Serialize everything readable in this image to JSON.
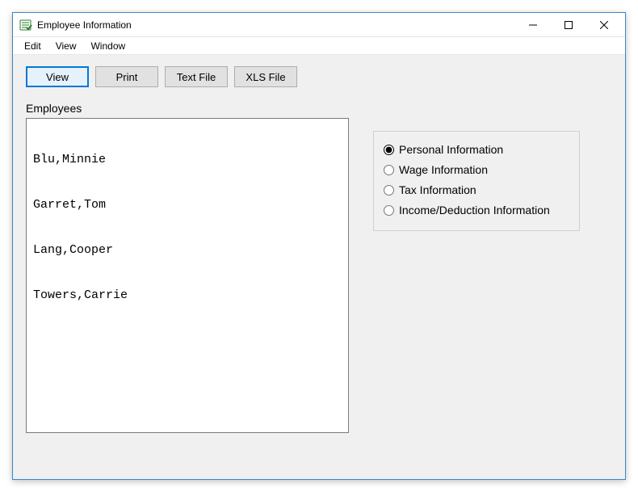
{
  "window": {
    "title": "Employee Information"
  },
  "menubar": {
    "items": [
      "Edit",
      "View",
      "Window"
    ]
  },
  "toolbar": {
    "buttons": [
      {
        "label": "View",
        "selected": true
      },
      {
        "label": "Print",
        "selected": false
      },
      {
        "label": "Text File",
        "selected": false
      },
      {
        "label": "XLS File",
        "selected": false
      }
    ]
  },
  "employees": {
    "label": "Employees",
    "list": [
      "Blu,Minnie",
      "Garret,Tom",
      "Lang,Cooper",
      "Towers,Carrie"
    ]
  },
  "infoOptions": {
    "items": [
      {
        "label": "Personal Information",
        "checked": true
      },
      {
        "label": "Wage Information",
        "checked": false
      },
      {
        "label": "Tax Information",
        "checked": false
      },
      {
        "label": "Income/Deduction Information",
        "checked": false
      }
    ]
  }
}
